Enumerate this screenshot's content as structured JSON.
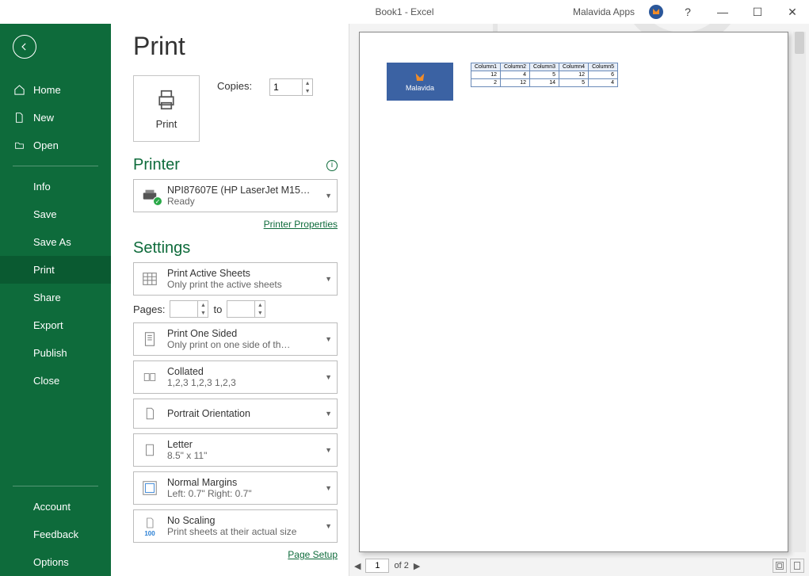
{
  "titlebar": {
    "doc": "Book1  -  Excel",
    "app": "Malavida Apps"
  },
  "sidebar": {
    "home": "Home",
    "new": "New",
    "open": "Open",
    "info": "Info",
    "save": "Save",
    "save_as": "Save As",
    "print": "Print",
    "share": "Share",
    "export": "Export",
    "publish": "Publish",
    "close": "Close",
    "account": "Account",
    "feedback": "Feedback",
    "options": "Options"
  },
  "page": {
    "title": "Print"
  },
  "print_tile": {
    "label": "Print"
  },
  "copies": {
    "label": "Copies:",
    "value": "1"
  },
  "printer": {
    "heading": "Printer",
    "name": "NPI87607E (HP LaserJet M15…",
    "status": "Ready",
    "properties": "Printer Properties"
  },
  "settings": {
    "heading": "Settings",
    "active_sheets": {
      "title": "Print Active Sheets",
      "sub": "Only print the active sheets"
    },
    "pages": {
      "label": "Pages:",
      "to": "to"
    },
    "sided": {
      "title": "Print One Sided",
      "sub": "Only print on one side of th…"
    },
    "collated": {
      "title": "Collated",
      "sub": "1,2,3    1,2,3    1,2,3"
    },
    "orientation": {
      "title": "Portrait Orientation"
    },
    "paper": {
      "title": "Letter",
      "sub": "8.5\" x 11\""
    },
    "margins": {
      "title": "Normal Margins",
      "sub": "Left:  0.7\"    Right:  0.7\""
    },
    "scaling": {
      "title": "No Scaling",
      "sub": "Print sheets at their actual size",
      "icon_num": "100"
    },
    "page_setup": "Page Setup"
  },
  "preview": {
    "logo_text": "Malavida",
    "table": {
      "headers": [
        "Column1",
        "Column2",
        "Column3",
        "Column4",
        "Column5"
      ],
      "rows": [
        [
          "12",
          "4",
          "5",
          "12",
          "6"
        ],
        [
          "2",
          "12",
          "14",
          "5",
          "4"
        ]
      ]
    },
    "nav": {
      "current": "1",
      "total": "of 2"
    }
  }
}
